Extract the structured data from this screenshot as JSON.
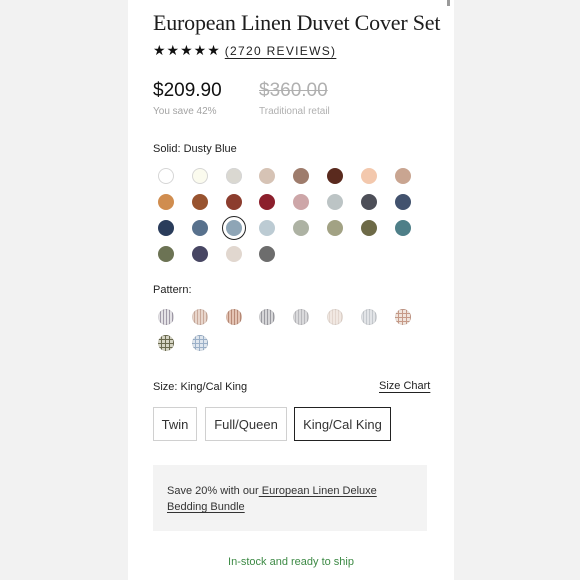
{
  "product": {
    "title": "European Linen Duvet Cover Set",
    "stars": "★★★★★",
    "reviews": "(2720 REVIEWS)",
    "price": "$209.90",
    "savings": "You save 42%",
    "original_price": "$360.00",
    "original_price_label": "Traditional retail"
  },
  "solid": {
    "label": "Solid: Dusty Blue",
    "selected_index": 18,
    "colors": [
      "#ffffff",
      "#fbfbee",
      "#dad8d1",
      "#d6c3b5",
      "#9e7c6c",
      "#5a2a1e",
      "#f3c8ad",
      "#c9a591",
      "#d08d4f",
      "#98532f",
      "#8c3d2e",
      "#8c1f2c",
      "#cda6a8",
      "#bcc4c5",
      "#4d4f58",
      "#42526e",
      "#2a3c5b",
      "#58718d",
      "#8ea5b6",
      "#bccbd3",
      "#adb2a3",
      "#a2a284",
      "#6d6a47",
      "#4e7f88",
      "#6c7354",
      "#474663",
      "#e1d7cf",
      "#6d6d6d"
    ]
  },
  "pattern": {
    "label": "Pattern:",
    "swatches": [
      {
        "base": "#e4e2e6",
        "stripe": "#a09aa8",
        "type": "v"
      },
      {
        "base": "#e8d6cc",
        "stripe": "#c9a99a",
        "type": "v"
      },
      {
        "base": "#e4c4b4",
        "stripe": "#b98a76",
        "type": "v"
      },
      {
        "base": "#d6d6d8",
        "stripe": "#9a9aa0",
        "type": "v"
      },
      {
        "base": "#dadadc",
        "stripe": "#b8b8bc",
        "type": "v"
      },
      {
        "base": "#f1e8e2",
        "stripe": "#e3d6ce",
        "type": "v"
      },
      {
        "base": "#e2e4e7",
        "stripe": "#c4c8cd",
        "type": "v"
      },
      {
        "base": "#f0e4dc",
        "stripe": "#c69a88",
        "type": "c"
      },
      {
        "base": "#d5d4c4",
        "stripe": "#6a6a4e",
        "type": "c"
      },
      {
        "base": "#dfe6ee",
        "stripe": "#9bb0c8",
        "type": "c"
      }
    ]
  },
  "size": {
    "label": "Size: King/Cal King",
    "chart_link": "Size Chart",
    "options": [
      "Twin",
      "Full/Queen",
      "King/Cal King"
    ],
    "selected": "King/Cal King"
  },
  "bundle": {
    "text": "Save 20% with our",
    "link": " European Linen Deluxe Bedding Bundle"
  },
  "stock": "In-stock and ready to ship"
}
